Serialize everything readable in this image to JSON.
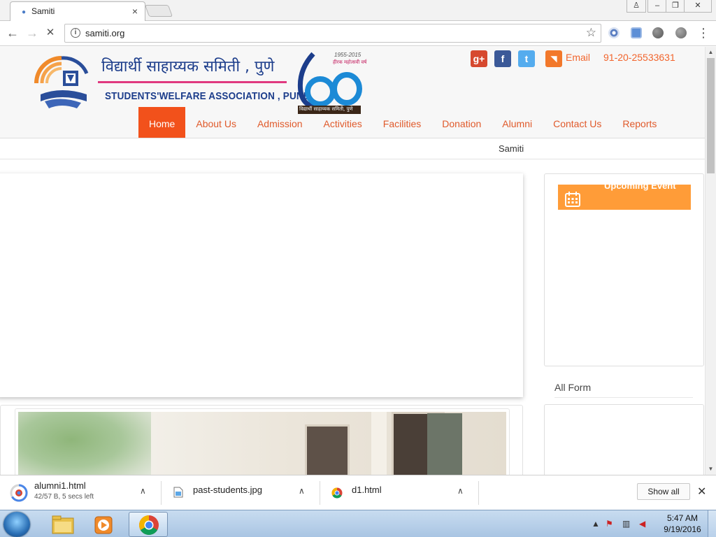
{
  "browser": {
    "tab_title": "Samiti",
    "tab_close": "×",
    "url": "samiti.org",
    "window_controls": [
      "♙",
      "–",
      "❐",
      "✕"
    ],
    "nav": {
      "back": "←",
      "forward": "→",
      "stop": "✕",
      "menu": "⋮",
      "star": "☆",
      "info": "i"
    }
  },
  "site": {
    "logo_hindi": "विद्यार्थी साहाय्यक समिती , पुणे",
    "logo_english": "STUDENTS'WELFARE ASSOCIATION , PUNE",
    "jubilee_years": "1955-2015",
    "jubilee_number": "60",
    "jubilee_caption": "हीरक महोत्सवी वर्ष",
    "jubilee_bar": "विद्यार्थी साहाय्यक समिती, पुणे",
    "social": [
      {
        "name": "google-plus",
        "glyph": "g+",
        "color": "#d6492f"
      },
      {
        "name": "facebook",
        "glyph": "f",
        "color": "#3b5998"
      },
      {
        "name": "twitter",
        "glyph": "t",
        "color": "#55acee"
      },
      {
        "name": "rss",
        "glyph": "◥",
        "color": "#f2782b"
      }
    ],
    "email_label": "Email",
    "phone": "91-20-25533631",
    "nav_items": [
      "Home",
      "About Us",
      "Admission",
      "Activities",
      "Facilities",
      "Donation",
      "Alumni",
      "Contact Us",
      "Reports"
    ],
    "active_nav": "Home",
    "ticker": "Samiti",
    "events_heading": "Upcoming Event",
    "all_form_title": "All Form"
  },
  "downloads": [
    {
      "name": "alumni1.html",
      "status": "42/57 B, 5 secs left",
      "chevron": "∧"
    },
    {
      "name": "past-students.jpg",
      "status": "",
      "chevron": "∧"
    },
    {
      "name": "d1.html",
      "status": "",
      "chevron": "∧"
    }
  ],
  "shelf": {
    "show_all": "Show all",
    "close": "✕"
  },
  "taskbar": {
    "time": "5:47 AM",
    "date": "9/19/2016"
  },
  "colors": {
    "accent_orange": "#f2652d",
    "nav_active_bg": "#f2511b",
    "event_header": "#ff9c38",
    "logo_blue": "#1c3d8b"
  }
}
